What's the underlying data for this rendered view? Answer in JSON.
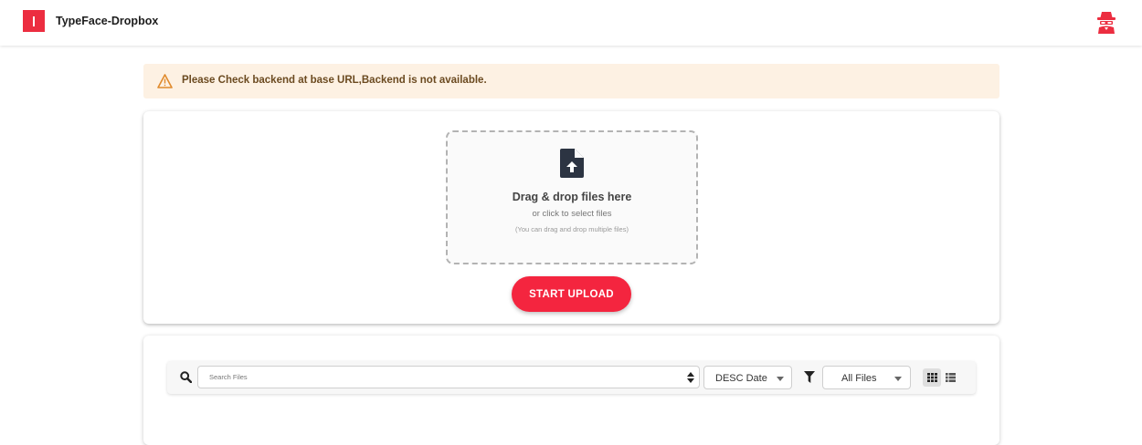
{
  "header": {
    "app_title": "TypeFace-Dropbox",
    "brand_color": "#ec2d40",
    "logo_icon": "brand-logo",
    "user_icon": "spy-avatar-icon"
  },
  "alert": {
    "icon": "warning-triangle-icon",
    "message": "Please Check backend at base URL,Backend is not available.",
    "background": "#fdf1e3"
  },
  "upload": {
    "icon": "file-upload-icon",
    "title": "Drag & drop files here",
    "subtitle": "or click to select files",
    "hint": "(You can drag and drop multiple files)",
    "button_label": "START UPLOAD",
    "button_color": "#f4253f"
  },
  "files": {
    "search_placeholder": "Search Files",
    "search_value": "",
    "sort_icon": "sort-icon",
    "sort_value": "DESC Date",
    "filter_icon": "filter-icon",
    "type_filter_value": "All Files",
    "view_modes": [
      "grid",
      "list"
    ],
    "active_view": "grid"
  }
}
